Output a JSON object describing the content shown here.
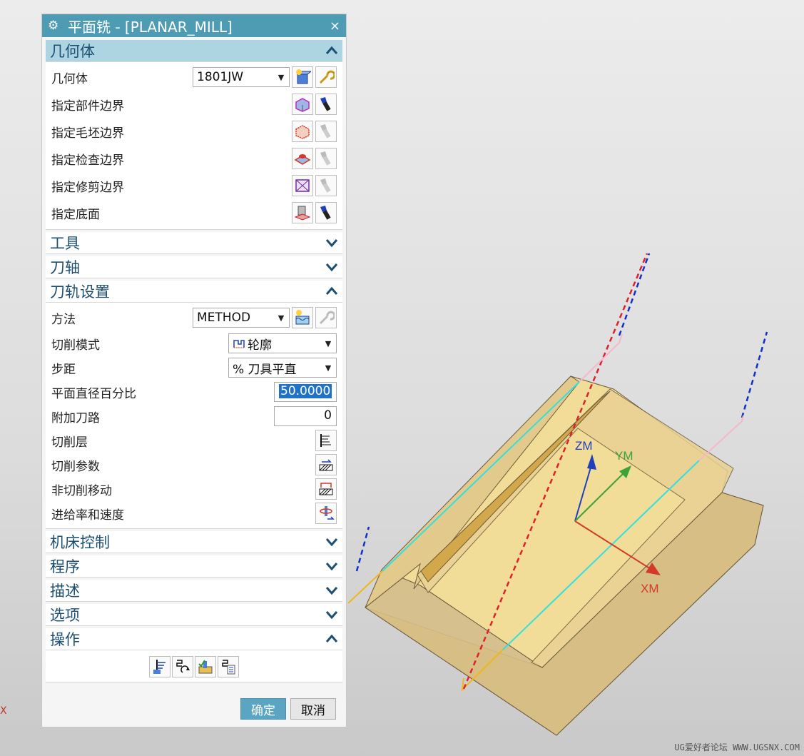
{
  "dialog": {
    "title": "平面铣 - [PLANAR_MILL]",
    "close_glyph": "×",
    "sections": {
      "geometry": {
        "label": "几何体",
        "rows": {
          "geometry": {
            "label": "几何体",
            "value": "1801JW"
          },
          "part_boundary": {
            "label": "指定部件边界"
          },
          "blank_boundary": {
            "label": "指定毛坯边界"
          },
          "check_boundary": {
            "label": "指定检查边界"
          },
          "trim_boundary": {
            "label": "指定修剪边界"
          },
          "floor": {
            "label": "指定底面"
          }
        }
      },
      "tool": {
        "label": "工具"
      },
      "axis": {
        "label": "刀轴"
      },
      "path": {
        "label": "刀轨设置",
        "rows": {
          "method": {
            "label": "方法",
            "value": "METHOD"
          },
          "cut_pattern": {
            "label": "切削模式",
            "value": "轮廓"
          },
          "stepover": {
            "label": "步距",
            "value": "% 刀具平直"
          },
          "percent": {
            "label": "平面直径百分比",
            "value": "50.0000"
          },
          "additional": {
            "label": "附加刀路",
            "value": "0"
          },
          "cut_levels": {
            "label": "切削层"
          },
          "cut_params": {
            "label": "切削参数"
          },
          "non_cutting": {
            "label": "非切削移动"
          },
          "feeds": {
            "label": "进给率和速度"
          }
        }
      },
      "machine": {
        "label": "机床控制"
      },
      "program": {
        "label": "程序"
      },
      "description": {
        "label": "描述"
      },
      "options": {
        "label": "选项"
      },
      "actions": {
        "label": "操作"
      }
    },
    "ok_label": "确定",
    "cancel_label": "取消"
  },
  "viewport": {
    "axes": {
      "z": "ZM",
      "y": "YM",
      "x": "XM"
    },
    "colors": {
      "part": "#e9d28f",
      "z": "#1f3fbf",
      "y": "#3aa33a",
      "x": "#d23a2a"
    },
    "stray_mark": "X"
  },
  "watermark": "UG爱好者论坛 WWW.UGSNX.COM"
}
